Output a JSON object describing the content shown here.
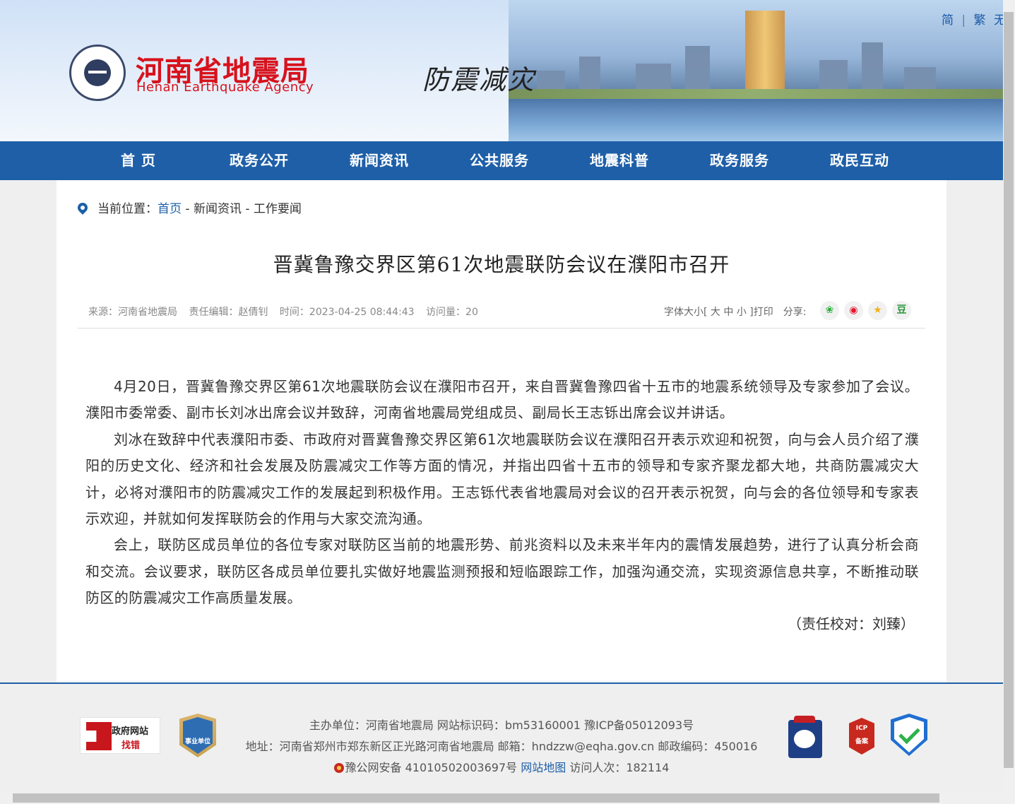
{
  "header": {
    "logo_cn": "河南省地震局",
    "logo_en": "Henan Earthquake Agency",
    "slogan": "防震减灾",
    "lang": [
      "简",
      "繁",
      "无"
    ]
  },
  "nav": {
    "items": [
      "首 页",
      "政务公开",
      "新闻资讯",
      "公共服务",
      "地震科普",
      "政务服务",
      "政民互动"
    ]
  },
  "breadcrumb": {
    "prefix": "当前位置：",
    "home": "首页",
    "rest": " - 新闻资讯 - 工作要闻"
  },
  "article": {
    "title": "晋冀鲁豫交界区第61次地震联防会议在濮阳市召开",
    "source": "来源：河南省地震局",
    "editor": "责任编辑：赵倩钊",
    "time": "时间：2023-04-25 08:44:43",
    "views": "访问量：20",
    "font_size_label": "字体大小[",
    "font_big": "大",
    "font_mid": "中",
    "font_small": "小",
    "font_close": "]",
    "print_label": "打印",
    "share_label": "分享:",
    "share_icons": [
      "wechat-icon",
      "weibo-icon",
      "qzone-icon",
      "douban-icon"
    ],
    "share_glyphs": [
      "❀",
      "◉",
      "★",
      "豆"
    ],
    "paragraphs": [
      "4月20日，晋冀鲁豫交界区第61次地震联防会议在濮阳市召开，来自晋冀鲁豫四省十五市的地震系统领导及专家参加了会议。濮阳市委常委、副市长刘冰出席会议并致辞，河南省地震局党组成员、副局长王志铄出席会议并讲话。",
      "刘冰在致辞中代表濮阳市委、市政府对晋冀鲁豫交界区第61次地震联防会议在濮阳召开表示欢迎和祝贺，向与会人员介绍了濮阳的历史文化、经济和社会发展及防震减灾工作等方面的情况，并指出四省十五市的领导和专家齐聚龙都大地，共商防震减灾大计，必将对濮阳市的防震减灾工作的发展起到积极作用。王志铄代表省地震局对会议的召开表示祝贺，向与会的各位领导和专家表示欢迎，并就如何发挥联防会的作用与大家交流沟通。",
      "会上，联防区成员单位的各位专家对联防区当前的地震形势、前兆资料以及未来半年内的震情发展趋势，进行了认真分析会商和交流。会议要求，联防区各成员单位要扎实做好地震监测预报和短临跟踪工作，加强沟通交流，实现资源信息共享，不断推动联防区的防震减灾工作高质量发展。"
    ],
    "signoff": "（责任校对：刘臻）"
  },
  "footer": {
    "line1": "主办单位：河南省地震局 网站标识码：bm53160001 豫ICP备05012093号",
    "line2": "地址：河南省郑州市郑东新区正光路河南省地震局 邮箱：hndzzw@eqha.gov.cn 邮政编码：450016",
    "line3_a": "豫公网安备 41010502003697号 ",
    "line3_link": "网站地图",
    "line3_b": " 访问人次：182114",
    "gov_badge_1": "政府网站",
    "gov_badge_2": "找错",
    "unit_badge": "事业单位",
    "icp_badge_1": "ICP",
    "icp_badge_2": "备案"
  },
  "colors": {
    "primary": "#1e5fa8",
    "logo_red": "#d7121c"
  }
}
